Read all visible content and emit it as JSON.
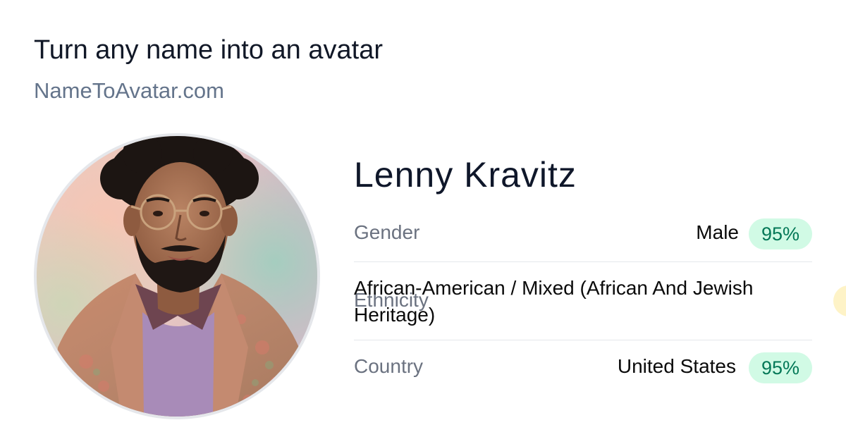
{
  "header": {
    "headline": "Turn any name into an avatar",
    "site": "NameToAvatar.com"
  },
  "profile": {
    "name": "Lenny Kravitz",
    "rows": [
      {
        "label": "Gender",
        "value": "Male",
        "confidence": "95%"
      },
      {
        "label": "Ethnicity",
        "value": "African-American / Mixed (African And Jewish Heritage)"
      },
      {
        "label": "Country",
        "value": "United States",
        "confidence": "95%"
      }
    ]
  },
  "colors": {
    "confidence_bg": "#d1fae5",
    "confidence_text": "#047857",
    "label": "#6b7280",
    "site": "#64748b"
  }
}
